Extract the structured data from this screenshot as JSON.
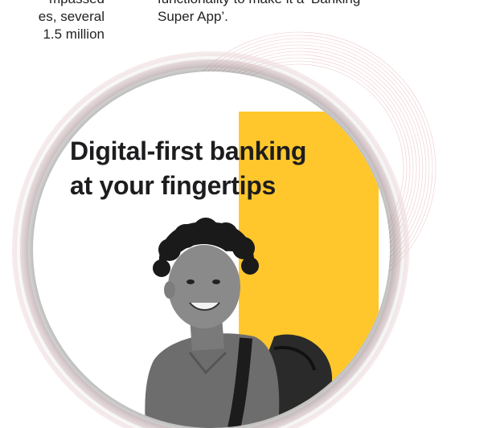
{
  "left_text": {
    "line1": "mpassed",
    "line2": "es, several",
    "line3": "1.5 million"
  },
  "right_text": {
    "line1": "functionality to make it a ‘Banking",
    "line2": "Super App’."
  },
  "promo_image": {
    "headline_line1_a": "Digital-first ",
    "headline_line1_b": "banking",
    "headline_line2_a": "at your finge",
    "headline_line2_b": "rtips",
    "accent_color": "#ffc72c",
    "headline_color": "#1d1d1f"
  },
  "decoration": {
    "arc_color_left": "#e8c9cc",
    "arc_color_right": "#e9b7bd"
  }
}
